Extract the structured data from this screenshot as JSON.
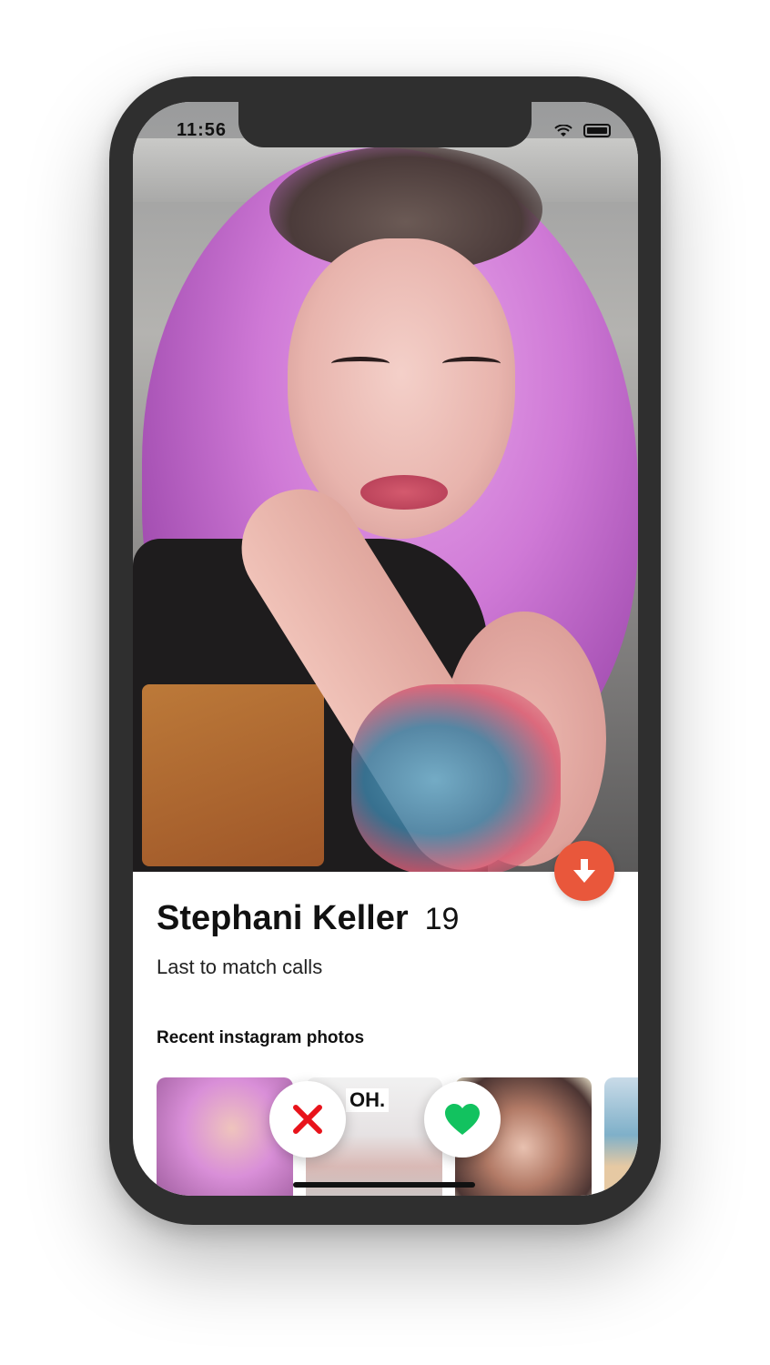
{
  "status_bar": {
    "time": "11:56",
    "icons": [
      "wifi-icon",
      "battery-icon"
    ]
  },
  "profile": {
    "name": "Stephani Keller",
    "age": "19",
    "tagline": "Last to match calls"
  },
  "instagram": {
    "title": "Recent instagram photos",
    "photos": [
      {
        "caption": ""
      },
      {
        "caption": "OH."
      },
      {
        "caption": ""
      },
      {
        "caption": ""
      }
    ]
  },
  "actions": {
    "dislike_icon": "close-icon",
    "like_icon": "heart-icon",
    "expand_icon": "arrow-down-icon",
    "colors": {
      "expand": "#e9573b",
      "dislike": "#e8131b",
      "like": "#12c25f"
    }
  }
}
